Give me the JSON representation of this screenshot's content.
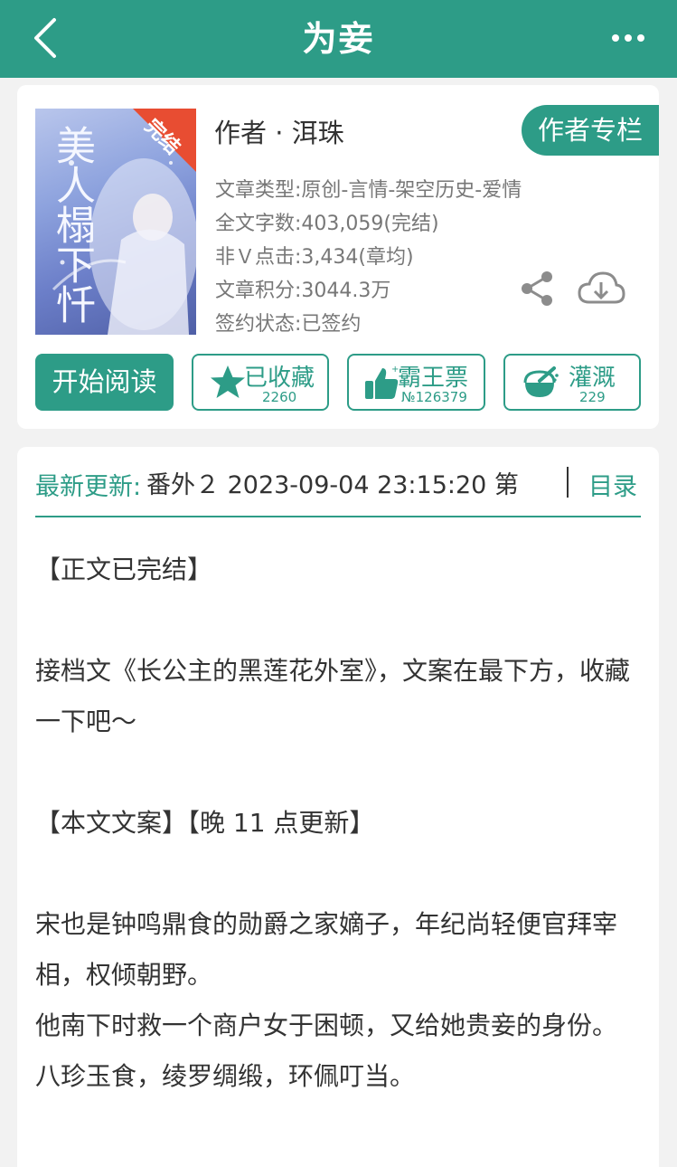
{
  "header": {
    "title": "为妾",
    "back_icon": "chevron-left-icon",
    "more_icon": "more-dots-icon"
  },
  "book": {
    "cover_title": "美人榻下忏",
    "cover_badge": "完结",
    "author_line": "作者 · 洱珠",
    "author_column_label": "作者专栏",
    "type": "文章类型:原创-言情-架空历史-爱情",
    "word_count": "全文字数:403,059(完结)",
    "clicks": "非Ｖ点击:3,434(章均)",
    "score": "文章积分:3044.3万",
    "sign_status": "签约状态:已签约"
  },
  "actions": {
    "read_label": "开始阅读",
    "collect": {
      "label": "已收藏",
      "count": "2260"
    },
    "vote": {
      "label": "霸王票",
      "count": "№126379"
    },
    "water": {
      "label": "灌溉",
      "count": "229"
    }
  },
  "update": {
    "label": "最新更新:",
    "text": "番外２ 2023-09-04 23:15:20  第",
    "catalog_label": "目录"
  },
  "description": {
    "lines": [
      "【正文已完结】",
      "",
      "接档文《长公主的黑莲花外室》，文案在最下方，收藏一下吧～",
      "",
      "【本文文案】【晚 11 点更新】",
      "",
      "宋也是钟鸣鼎食的勋爵之家嫡子，年纪尚轻便官拜宰相，权倾朝野。",
      "他南下时救一个商户女于困顿，又给她贵妾的身份。",
      "八珍玉食，绫罗绸缎，环佩叮当。"
    ]
  },
  "colors": {
    "brand": "#2d9c87",
    "background": "#f2f2f2",
    "text": "#333333",
    "muted": "#777777"
  }
}
